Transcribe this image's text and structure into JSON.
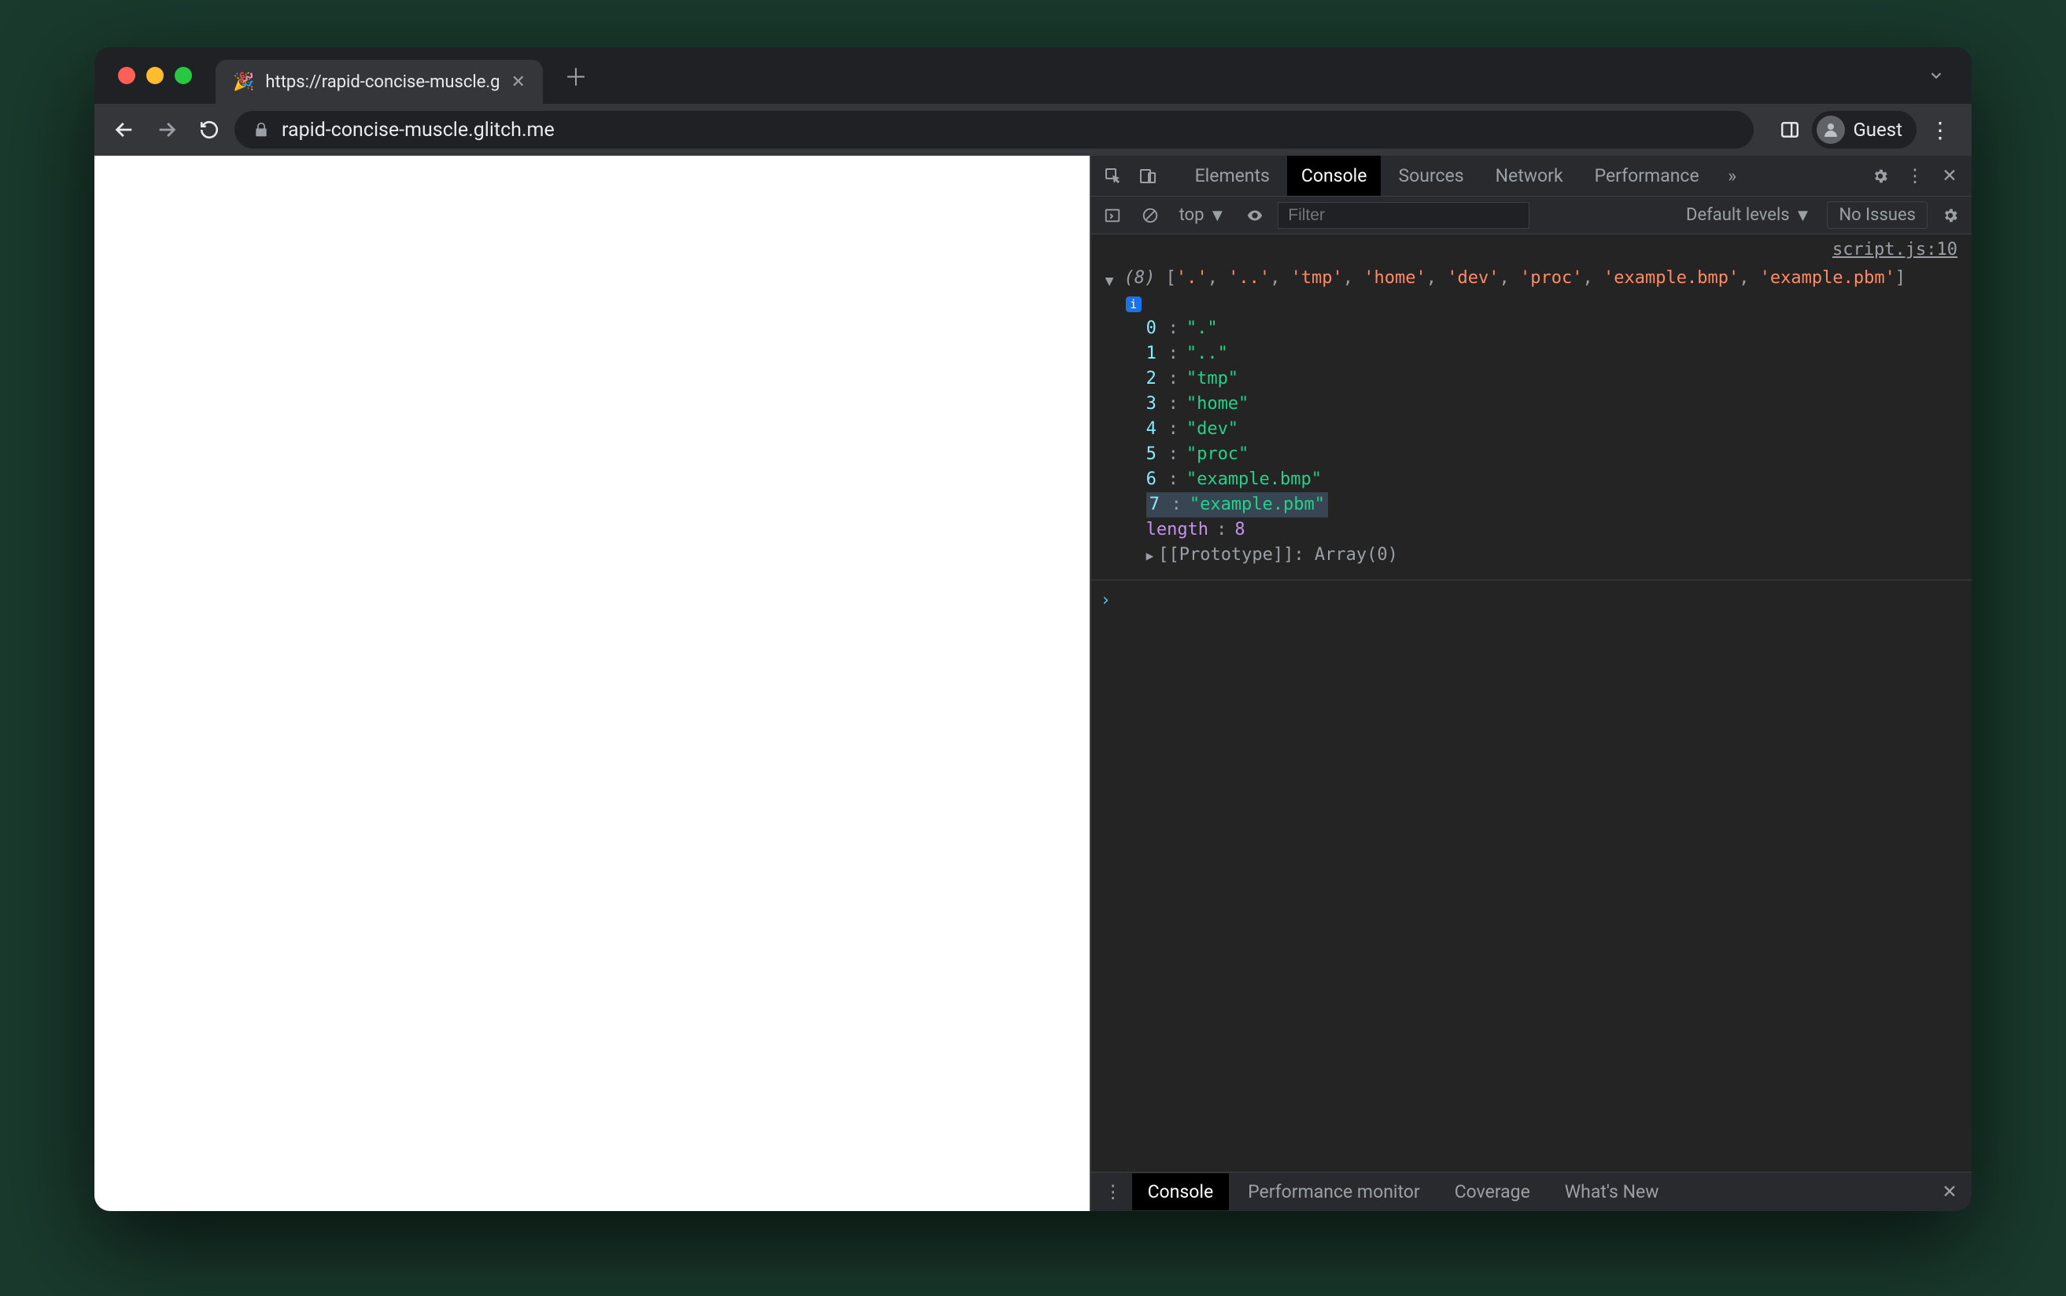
{
  "window": {
    "tab_favicon": "🎉",
    "tab_title": "https://rapid-concise-muscle.g",
    "url_display": "rapid-concise-muscle.glitch.me",
    "guest_label": "Guest"
  },
  "devtools": {
    "tabs": [
      "Elements",
      "Console",
      "Sources",
      "Network",
      "Performance"
    ],
    "active_tab": "Console",
    "more_tabs_glyph": "»"
  },
  "console_toolbar": {
    "context_label": "top",
    "filter_placeholder": "Filter",
    "levels_label": "Default levels",
    "issues_label": "No Issues"
  },
  "console": {
    "source_link": "script.js:10",
    "array_count": "(8)",
    "array_preview": [
      "'.'",
      "'..'",
      "'tmp'",
      "'home'",
      "'dev'",
      "'proc'",
      "'example.bmp'",
      "'example.pbm'"
    ],
    "entries": [
      {
        "index": "0",
        "value": "\".\""
      },
      {
        "index": "1",
        "value": "\"..\""
      },
      {
        "index": "2",
        "value": "\"tmp\""
      },
      {
        "index": "3",
        "value": "\"home\""
      },
      {
        "index": "4",
        "value": "\"dev\""
      },
      {
        "index": "5",
        "value": "\"proc\""
      },
      {
        "index": "6",
        "value": "\"example.bmp\""
      },
      {
        "index": "7",
        "value": "\"example.pbm\""
      }
    ],
    "highlight_index": 7,
    "length_key": "length",
    "length_value": "8",
    "prototype_label": "[[Prototype]]",
    "prototype_value": "Array(0)"
  },
  "drawer": {
    "tabs": [
      "Console",
      "Performance monitor",
      "Coverage",
      "What's New"
    ],
    "active_tab": "Console"
  }
}
